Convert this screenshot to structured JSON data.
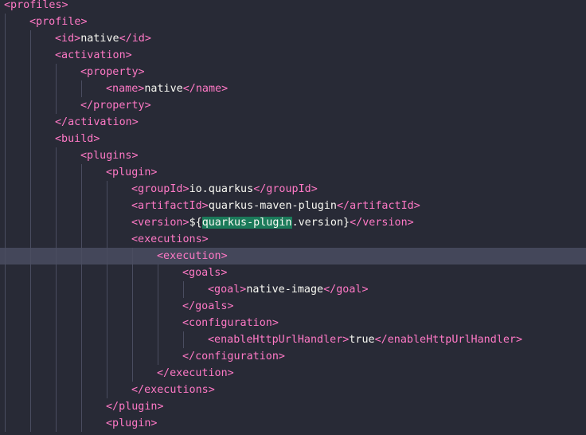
{
  "editor": {
    "language": "xml",
    "current_line_index": 15,
    "colors": {
      "background": "#282a36",
      "tag": "#ff79c6",
      "text": "#f8f8f2",
      "current_line": "#44475a",
      "search_highlight": "#1b7a5a",
      "indent_guide": "#4a4d60"
    },
    "lines": [
      {
        "indent": 0,
        "tokens": [
          {
            "t": "<profiles>",
            "k": "tag"
          }
        ]
      },
      {
        "indent": 1,
        "tokens": [
          {
            "t": "<profile>",
            "k": "tag"
          }
        ]
      },
      {
        "indent": 2,
        "tokens": [
          {
            "t": "<id>",
            "k": "tag"
          },
          {
            "t": "native",
            "k": "txt"
          },
          {
            "t": "</id>",
            "k": "tag"
          }
        ]
      },
      {
        "indent": 2,
        "tokens": [
          {
            "t": "<activation>",
            "k": "tag"
          }
        ]
      },
      {
        "indent": 3,
        "tokens": [
          {
            "t": "<property>",
            "k": "tag"
          }
        ]
      },
      {
        "indent": 4,
        "tokens": [
          {
            "t": "<name>",
            "k": "tag"
          },
          {
            "t": "native",
            "k": "txt"
          },
          {
            "t": "</name>",
            "k": "tag"
          }
        ]
      },
      {
        "indent": 3,
        "tokens": [
          {
            "t": "</property>",
            "k": "tag"
          }
        ]
      },
      {
        "indent": 2,
        "tokens": [
          {
            "t": "</activation>",
            "k": "tag"
          }
        ]
      },
      {
        "indent": 2,
        "tokens": [
          {
            "t": "<build>",
            "k": "tag"
          }
        ]
      },
      {
        "indent": 3,
        "tokens": [
          {
            "t": "<plugins>",
            "k": "tag"
          }
        ]
      },
      {
        "indent": 4,
        "tokens": [
          {
            "t": "<plugin>",
            "k": "tag"
          }
        ]
      },
      {
        "indent": 5,
        "tokens": [
          {
            "t": "<groupId>",
            "k": "tag"
          },
          {
            "t": "io.quarkus",
            "k": "txt"
          },
          {
            "t": "</groupId>",
            "k": "tag"
          }
        ]
      },
      {
        "indent": 5,
        "tokens": [
          {
            "t": "<artifactId>",
            "k": "tag"
          },
          {
            "t": "quarkus-maven-plugin",
            "k": "txt"
          },
          {
            "t": "</artifactId>",
            "k": "tag"
          }
        ]
      },
      {
        "indent": 5,
        "tokens": [
          {
            "t": "<version>",
            "k": "tag"
          },
          {
            "t": "${",
            "k": "txt"
          },
          {
            "t": "quarkus-plugin",
            "k": "hl"
          },
          {
            "t": ".version}",
            "k": "txt"
          },
          {
            "t": "</version>",
            "k": "tag"
          }
        ]
      },
      {
        "indent": 5,
        "tokens": [
          {
            "t": "<executions>",
            "k": "tag"
          }
        ]
      },
      {
        "indent": 6,
        "tokens": [
          {
            "t": "<execution>",
            "k": "tag"
          }
        ]
      },
      {
        "indent": 7,
        "tokens": [
          {
            "t": "<goals>",
            "k": "tag"
          }
        ]
      },
      {
        "indent": 8,
        "tokens": [
          {
            "t": "<goal>",
            "k": "tag"
          },
          {
            "t": "native-image",
            "k": "txt"
          },
          {
            "t": "</goal>",
            "k": "tag"
          }
        ]
      },
      {
        "indent": 7,
        "tokens": [
          {
            "t": "</goals>",
            "k": "tag"
          }
        ]
      },
      {
        "indent": 7,
        "tokens": [
          {
            "t": "<configuration>",
            "k": "tag"
          }
        ]
      },
      {
        "indent": 8,
        "tokens": [
          {
            "t": "<enableHttpUrlHandler>",
            "k": "tag"
          },
          {
            "t": "true",
            "k": "txt"
          },
          {
            "t": "</enableHttpUrlHandler>",
            "k": "tag"
          }
        ]
      },
      {
        "indent": 7,
        "tokens": [
          {
            "t": "</configuration>",
            "k": "tag"
          }
        ]
      },
      {
        "indent": 6,
        "tokens": [
          {
            "t": "</execution>",
            "k": "tag"
          }
        ]
      },
      {
        "indent": 5,
        "tokens": [
          {
            "t": "</executions>",
            "k": "tag"
          }
        ]
      },
      {
        "indent": 4,
        "tokens": [
          {
            "t": "</plugin>",
            "k": "tag"
          }
        ]
      },
      {
        "indent": 4,
        "tokens": [
          {
            "t": "<plugin>",
            "k": "tag"
          }
        ]
      }
    ]
  }
}
